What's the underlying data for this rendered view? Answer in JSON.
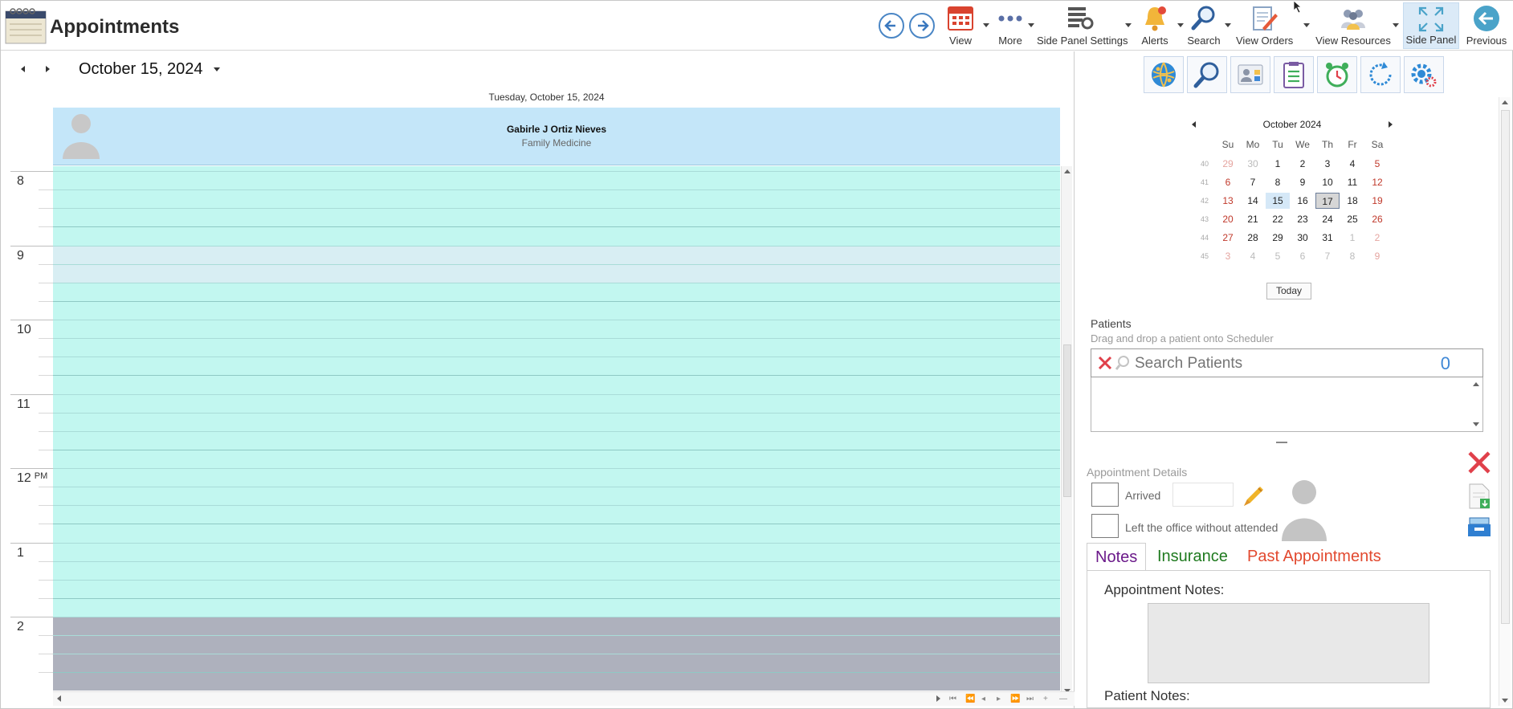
{
  "window": {
    "title": "Appointments",
    "logo_icon": "appointments-book-icon"
  },
  "toolbar": {
    "back_icon": "arrow-left-icon",
    "forward_icon": "arrow-right-icon",
    "buttons": [
      {
        "label": "View",
        "icon": "calendar-icon"
      },
      {
        "label": "More",
        "icon": "more-dots-icon"
      },
      {
        "label": "Side Panel Settings",
        "icon": "panel-settings-icon"
      },
      {
        "label": "Alerts",
        "icon": "bell-icon"
      },
      {
        "label": "Search",
        "icon": "search-icon"
      },
      {
        "label": "View Orders",
        "icon": "orders-icon"
      },
      {
        "label": "View Resources",
        "icon": "resources-icon"
      },
      {
        "label": "Side Panel",
        "icon": "expand-icon"
      },
      {
        "label": "Previous",
        "icon": "previous-icon"
      }
    ]
  },
  "scheduler": {
    "current_date": "October 15, 2024",
    "day_header": "Tuesday, October 15, 2024",
    "resource": {
      "name": "Gabirle J Ortiz Nieves",
      "department": "Family Medicine"
    },
    "hours": [
      {
        "label": "8",
        "ampm": ""
      },
      {
        "label": "9",
        "ampm": ""
      },
      {
        "label": "10",
        "ampm": ""
      },
      {
        "label": "11",
        "ampm": ""
      },
      {
        "label": "12",
        "ampm": "PM"
      },
      {
        "label": "1",
        "ampm": ""
      },
      {
        "label": "2",
        "ampm": ""
      }
    ],
    "colors": {
      "available": "#c2f7f0",
      "highlight": "#d8eef3",
      "off_hours": "#aeb1bd",
      "resource_header": "#c4e6f9"
    }
  },
  "side_panel": {
    "quick_icons": [
      "globe-network-icon",
      "magnifier-icon",
      "patient-card-icon",
      "clipboard-list-icon",
      "alarm-clock-icon",
      "refresh-icon",
      "settings-gears-icon"
    ],
    "calendar": {
      "month_label": "October 2024",
      "weekdays": [
        "Su",
        "Mo",
        "Tu",
        "We",
        "Th",
        "Fr",
        "Sa"
      ],
      "weeks": [
        {
          "num": "40",
          "days": [
            "29",
            "30",
            "1",
            "2",
            "3",
            "4",
            "5"
          ]
        },
        {
          "num": "41",
          "days": [
            "6",
            "7",
            "8",
            "9",
            "10",
            "11",
            "12"
          ]
        },
        {
          "num": "42",
          "days": [
            "13",
            "14",
            "15",
            "16",
            "17",
            "18",
            "19"
          ]
        },
        {
          "num": "43",
          "days": [
            "20",
            "21",
            "22",
            "23",
            "24",
            "25",
            "26"
          ]
        },
        {
          "num": "44",
          "days": [
            "27",
            "28",
            "29",
            "30",
            "31",
            "1",
            "2"
          ]
        },
        {
          "num": "45",
          "days": [
            "3",
            "4",
            "5",
            "6",
            "7",
            "8",
            "9"
          ]
        }
      ],
      "today_label": "Today"
    },
    "patients": {
      "title": "Patients",
      "hint": "Drag and drop a patient onto Scheduler",
      "search_placeholder": "Search Patients",
      "count": "0"
    },
    "appointment_details": {
      "title": "Appointment Details",
      "arrived_label": "Arrived",
      "left_label": "Left the office without attended",
      "tabs": [
        "Notes",
        "Insurance",
        "Past Appointments"
      ],
      "appointment_notes_label": "Appointment Notes:",
      "patient_notes_label": "Patient Notes:"
    },
    "actions": [
      "delete-x-icon",
      "document-download-icon",
      "archive-tray-icon"
    ]
  }
}
